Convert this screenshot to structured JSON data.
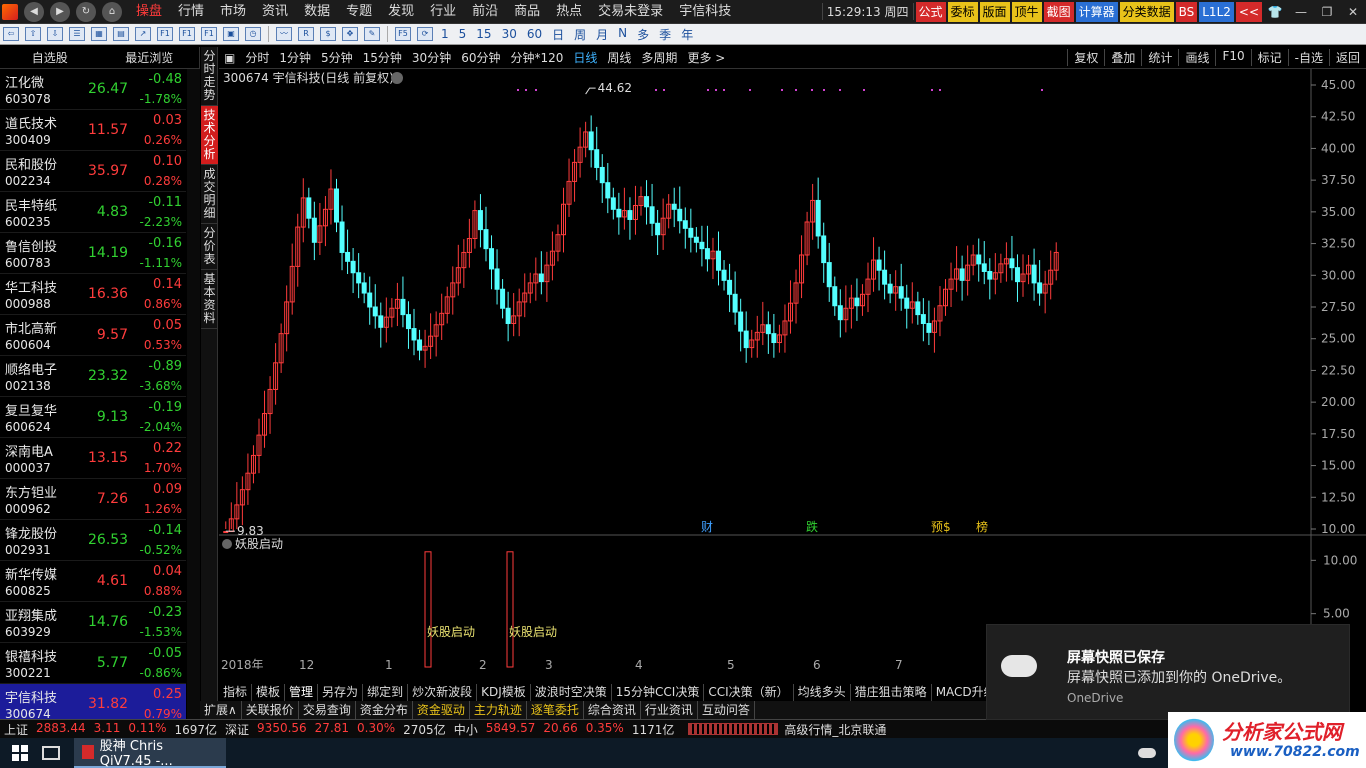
{
  "menubar": {
    "items": [
      "操盘",
      "行情",
      "市场",
      "资讯",
      "数据",
      "专题",
      "发现",
      "行业",
      "前沿",
      "商品",
      "热点",
      "交易未登录",
      "宇信科技"
    ],
    "clock": "15:29:13 周四",
    "buttons": [
      {
        "label": "公式",
        "color": "red"
      },
      {
        "label": "委标",
        "color": "yellow"
      },
      {
        "label": "版面",
        "color": "yellow"
      },
      {
        "label": "顶牛",
        "color": "yellow"
      },
      {
        "label": "截图",
        "color": "red"
      },
      {
        "label": "计算器",
        "color": "blue"
      },
      {
        "label": "分类数据",
        "color": "yellow"
      },
      {
        "label": "BS",
        "color": "red"
      },
      {
        "label": "L1L2",
        "color": "blue"
      },
      {
        "label": "<<",
        "color": "red"
      }
    ]
  },
  "toolbar": {
    "digits": [
      "1",
      "5",
      "15",
      "30",
      "60"
    ],
    "periods": [
      "日",
      "周",
      "月",
      "N",
      "多",
      "季",
      "年"
    ]
  },
  "watchlist": {
    "tabs": [
      "自选股",
      "最近浏览"
    ],
    "rows": [
      {
        "name": "江化微",
        "code": "603078",
        "price": "26.47",
        "chg": "-0.48",
        "pct": "-1.78%",
        "dir": "dn"
      },
      {
        "name": "道氏技术",
        "code": "300409",
        "price": "11.57",
        "chg": "0.03",
        "pct": "0.26%",
        "dir": "up"
      },
      {
        "name": "民和股份",
        "code": "002234",
        "price": "35.97",
        "chg": "0.10",
        "pct": "0.28%",
        "dir": "up"
      },
      {
        "name": "民丰特纸",
        "code": "600235",
        "price": "4.83",
        "chg": "-0.11",
        "pct": "-2.23%",
        "dir": "dn"
      },
      {
        "name": "鲁信创投",
        "code": "600783",
        "price": "14.19",
        "chg": "-0.16",
        "pct": "-1.11%",
        "dir": "dn"
      },
      {
        "name": "华工科技",
        "code": "000988",
        "price": "16.36",
        "chg": "0.14",
        "pct": "0.86%",
        "dir": "up"
      },
      {
        "name": "市北高新",
        "code": "600604",
        "price": "9.57",
        "chg": "0.05",
        "pct": "0.53%",
        "dir": "up"
      },
      {
        "name": "顺络电子",
        "code": "002138",
        "price": "23.32",
        "chg": "-0.89",
        "pct": "-3.68%",
        "dir": "dn"
      },
      {
        "name": "复旦复华",
        "code": "600624",
        "price": "9.13",
        "chg": "-0.19",
        "pct": "-2.04%",
        "dir": "dn"
      },
      {
        "name": "深南电A",
        "code": "000037",
        "price": "13.15",
        "chg": "0.22",
        "pct": "1.70%",
        "dir": "up"
      },
      {
        "name": "东方钽业",
        "code": "000962",
        "price": "7.26",
        "chg": "0.09",
        "pct": "1.26%",
        "dir": "up"
      },
      {
        "name": "锋龙股份",
        "code": "002931",
        "price": "26.53",
        "chg": "-0.14",
        "pct": "-0.52%",
        "dir": "dn"
      },
      {
        "name": "新华传媒",
        "code": "600825",
        "price": "4.61",
        "chg": "0.04",
        "pct": "0.88%",
        "dir": "up"
      },
      {
        "name": "亚翔集成",
        "code": "603929",
        "price": "14.76",
        "chg": "-0.23",
        "pct": "-1.53%",
        "dir": "dn"
      },
      {
        "name": "银禧科技",
        "code": "300221",
        "price": "5.77",
        "chg": "-0.05",
        "pct": "-0.86%",
        "dir": "dn"
      },
      {
        "name": "宇信科技",
        "code": "300674",
        "price": "31.82",
        "chg": "0.25",
        "pct": "0.79%",
        "dir": "up",
        "selected": true
      }
    ]
  },
  "vtabs": [
    "分时走势",
    "技术分析",
    "成交明细",
    "分价表",
    "基本资料"
  ],
  "period_bar": {
    "left": [
      "分时",
      "1分钟",
      "5分钟",
      "15分钟",
      "30分钟",
      "60分钟",
      "分钟*120",
      "日线",
      "周线",
      "多周期",
      "更多 >"
    ],
    "active": "日线",
    "right": [
      "复权",
      "叠加",
      "统计",
      "画线",
      "F10",
      "标记",
      "-自选",
      "返回"
    ]
  },
  "chart_data": [
    {
      "type": "candlestick",
      "title": "300674 宇信科技(日线 前复权)",
      "y_ticks": [
        "45.00",
        "42.50",
        "40.00",
        "37.50",
        "35.00",
        "32.50",
        "30.00",
        "27.50",
        "25.00",
        "22.50",
        "20.00",
        "17.50",
        "15.00",
        "12.50",
        "10.00"
      ],
      "ylim": [
        10.0,
        45.0
      ],
      "annotations": {
        "high": "44.62",
        "low": "9.83"
      },
      "event_labels": [
        "财",
        "跌",
        "预$",
        "榜"
      ],
      "x_labels": [
        "2018年",
        "12",
        "1",
        "2",
        "3",
        "4",
        "5",
        "6",
        "7"
      ],
      "ohlc_close": [
        9.8,
        10.8,
        11.9,
        13.1,
        14.4,
        15.8,
        17.4,
        19.1,
        21,
        23.1,
        25.4,
        27.9,
        30.7,
        33.8,
        36.1,
        34.5,
        32.6,
        33.9,
        35.2,
        36.8,
        34.2,
        31.8,
        31.1,
        30.2,
        29.4,
        28.6,
        27.5,
        26.8,
        25.9,
        26.7,
        27.4,
        28.1,
        26.9,
        25.8,
        24.9,
        24.1,
        24.4,
        25.2,
        26.1,
        27,
        28.3,
        29.4,
        30.6,
        31.8,
        32.9,
        35.1,
        33.6,
        32.1,
        30.5,
        28.9,
        27.4,
        26.2,
        26.8,
        27.9,
        28.6,
        29.4,
        30.1,
        29.5,
        30.8,
        31.9,
        33.2,
        35.6,
        37.4,
        38.9,
        40.1,
        41.3,
        39.9,
        38.5,
        37.3,
        36.1,
        35.2,
        34.6,
        35.1,
        34.4,
        35.5,
        36.2,
        35.4,
        34.1,
        33.2,
        34.5,
        35.6,
        35.2,
        34.3,
        33.7,
        33,
        32.6,
        32.1,
        31.3,
        31.9,
        30.4,
        29.6,
        28.5,
        27.1,
        25.6,
        24.3,
        24.9,
        25.5,
        26.1,
        25.4,
        24.7,
        25.3,
        26.4,
        27.8,
        29.4,
        31.6,
        34.2,
        35.9,
        33.1,
        31,
        29.1,
        27.6,
        26.5,
        27.4,
        28.2,
        27.6,
        28.5,
        29.7,
        31.2,
        30.4,
        29.3,
        28.6,
        29.1,
        28.2,
        27.4,
        27.9,
        26.9,
        26.2,
        25.5,
        26.4,
        27.6,
        28.9,
        29.7,
        30.5,
        29.6,
        30.8,
        31.6,
        30.9,
        30.3,
        29.7,
        30.2,
        30.9,
        31.3,
        30.6,
        29.5,
        30.1,
        30.8,
        29.4,
        28.6,
        29.3,
        30.4,
        31.8
      ]
    },
    {
      "type": "indicator",
      "title": "妖股启动",
      "y_ticks": [
        "10.00",
        "5.00"
      ],
      "ylim": [
        0,
        12
      ],
      "signals": [
        {
          "label": "妖股启动",
          "value": 10
        },
        {
          "label": "妖股启动",
          "value": 10
        }
      ]
    }
  ],
  "formula_tabs": [
    "指标",
    "模板",
    "管理",
    "另存为",
    "绑定到",
    "炒次新波段",
    "KDJ模板",
    "波浪时空决策",
    "15分钟CCI决策",
    "CCI决策（新）",
    "均线多头",
    "猎庄狙击策略",
    "MACD升级:"
  ],
  "bottom_tabs": [
    "扩展∧",
    "关联报价",
    "交易查询",
    "资金分布",
    "资金驱动",
    "主力轨迹",
    "逐笔委托",
    "综合资讯",
    "行业资讯",
    "互动问答"
  ],
  "index_bar": [
    {
      "name": "上证",
      "value": "2883.44",
      "chg": "3.11",
      "pct": "0.11%",
      "amt": "1697亿",
      "dir": "up"
    },
    {
      "name": "深证",
      "value": "9350.56",
      "chg": "27.81",
      "pct": "0.30%",
      "amt": "2705亿",
      "dir": "up"
    },
    {
      "name": "中小",
      "value": "5849.57",
      "chg": "20.66",
      "pct": "0.35%",
      "amt": "1171亿",
      "dir": "up"
    }
  ],
  "net_info": "高级行情_北京联通",
  "taskbar": {
    "app": "股神 Chris QiV7.45 -..."
  },
  "toast": {
    "title": "屏幕快照已保存",
    "body": "屏幕快照已添加到你的 OneDrive。",
    "source": "OneDrive"
  },
  "watermark": {
    "name": "分析家公式网",
    "url": "www.70822.com"
  }
}
